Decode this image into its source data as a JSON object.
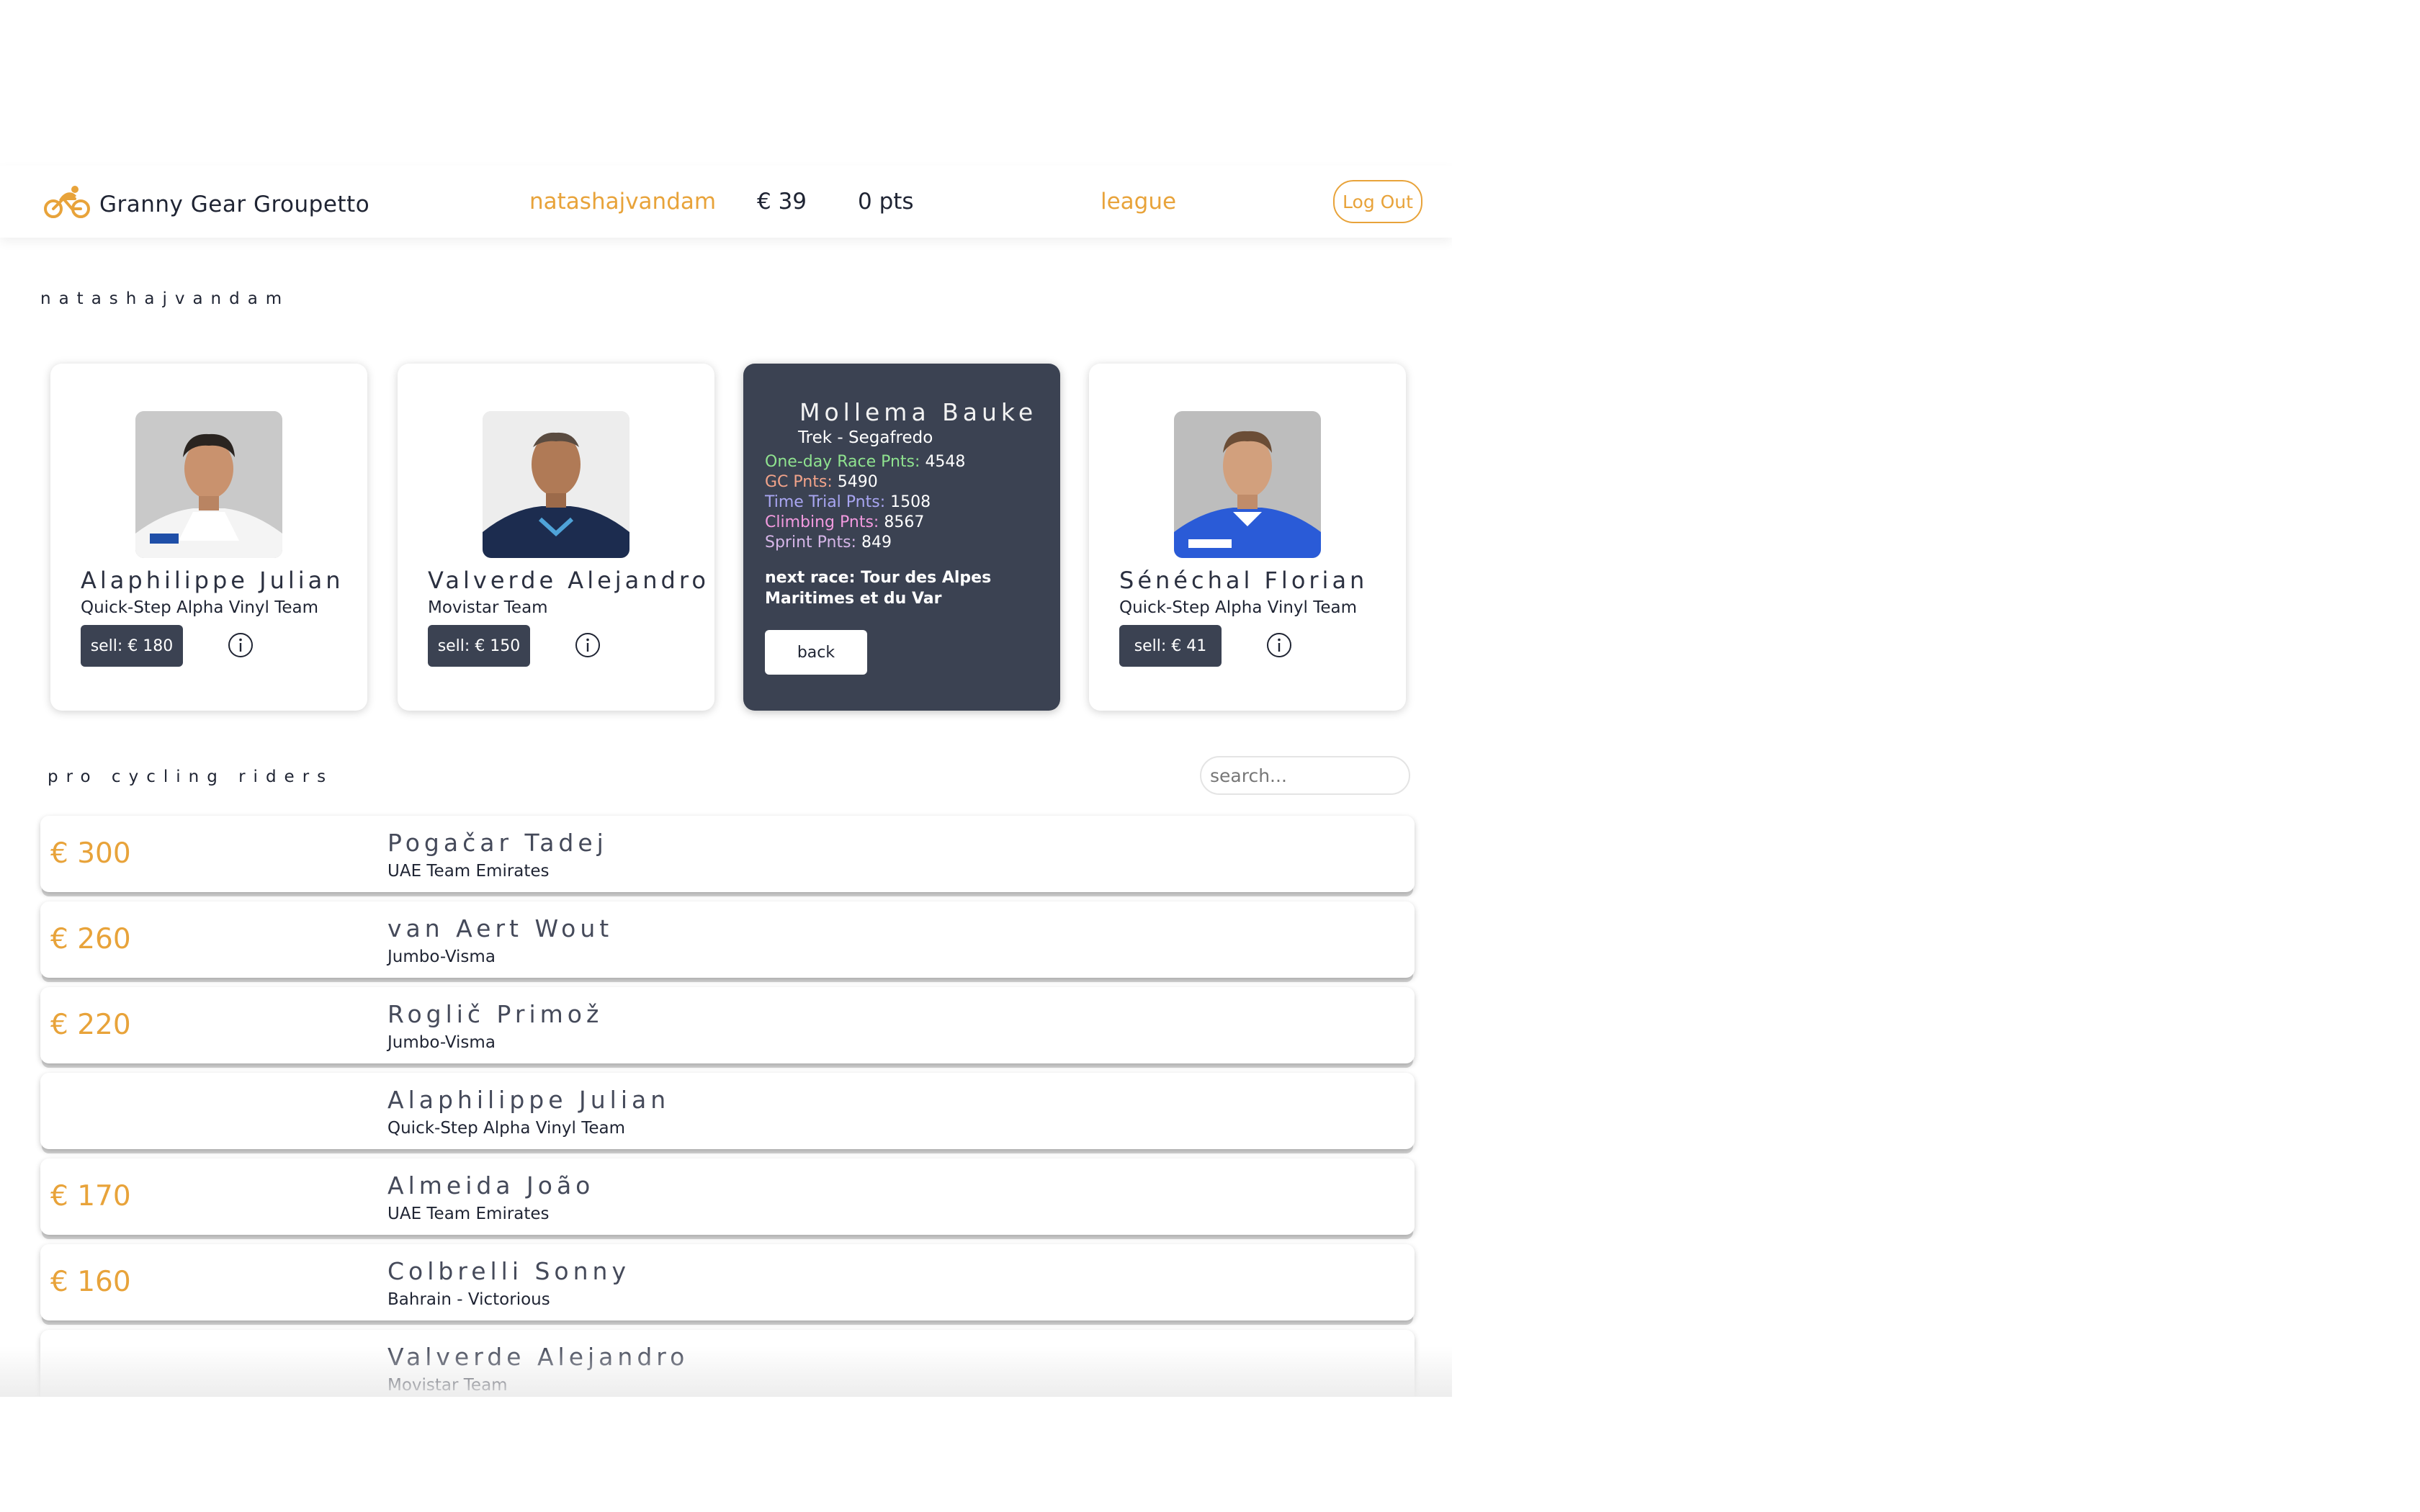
{
  "colors": {
    "accent": "#e8a33a",
    "dark_card": "#3b4252",
    "text": "#1f2433"
  },
  "navbar": {
    "brand_icon": "cyclist-icon",
    "brand_name": "Granny Gear Groupetto",
    "username": "natashajvandam",
    "budget": "€ 39",
    "points": "0 pts",
    "league_link": "league",
    "logout_label": "Log Out"
  },
  "team": {
    "title": "natashajvandam",
    "cards": [
      {
        "name": "Alaphilippe Julian",
        "team": "Quick-Step Alpha Vinyl Team",
        "sell_label": "sell: € 180",
        "photo": "rider-photo",
        "info_icon": "info-icon"
      },
      {
        "name": "Valverde Alejandro",
        "team": "Movistar Team",
        "sell_label": "sell: € 150",
        "photo": "rider-photo",
        "info_icon": "info-icon"
      },
      {
        "name": "Mollema Bauke",
        "team": "Trek - Segafredo",
        "stats": [
          {
            "label": "One-day Race Pnts:",
            "value": "4548",
            "color": "#8fe38f"
          },
          {
            "label": "GC Pnts:",
            "value": "5490",
            "color": "#f2a38a"
          },
          {
            "label": "Time Trial Pnts:",
            "value": "1508",
            "color": "#a9a6f2"
          },
          {
            "label": "Climbing Pnts:",
            "value": "8567",
            "color": "#f29adf"
          },
          {
            "label": "Sprint Pnts:",
            "value": "849",
            "color": "#d6b6e8"
          }
        ],
        "next_race": "next race: Tour des Alpes Maritimes et du Var",
        "back_label": "back"
      },
      {
        "name": "Sénéchal Florian",
        "team": "Quick-Step Alpha Vinyl Team",
        "sell_label": "sell: € 41",
        "photo": "rider-photo",
        "info_icon": "info-icon"
      }
    ]
  },
  "riders": {
    "title": "pro cycling riders",
    "search_placeholder": "search...",
    "list": [
      {
        "price": "€ 300",
        "name": "Pogačar Tadej",
        "team": "UAE Team Emirates"
      },
      {
        "price": "€ 260",
        "name": "van Aert Wout",
        "team": "Jumbo-Visma"
      },
      {
        "price": "€ 220",
        "name": "Roglič Primož",
        "team": "Jumbo-Visma"
      },
      {
        "price": "",
        "name": "Alaphilippe Julian",
        "team": "Quick-Step Alpha Vinyl Team"
      },
      {
        "price": "€ 170",
        "name": "Almeida João",
        "team": "UAE Team Emirates"
      },
      {
        "price": "€ 160",
        "name": "Colbrelli Sonny",
        "team": "Bahrain - Victorious"
      },
      {
        "price": "",
        "name": "Valverde Alejandro",
        "team": "Movistar Team"
      }
    ]
  }
}
